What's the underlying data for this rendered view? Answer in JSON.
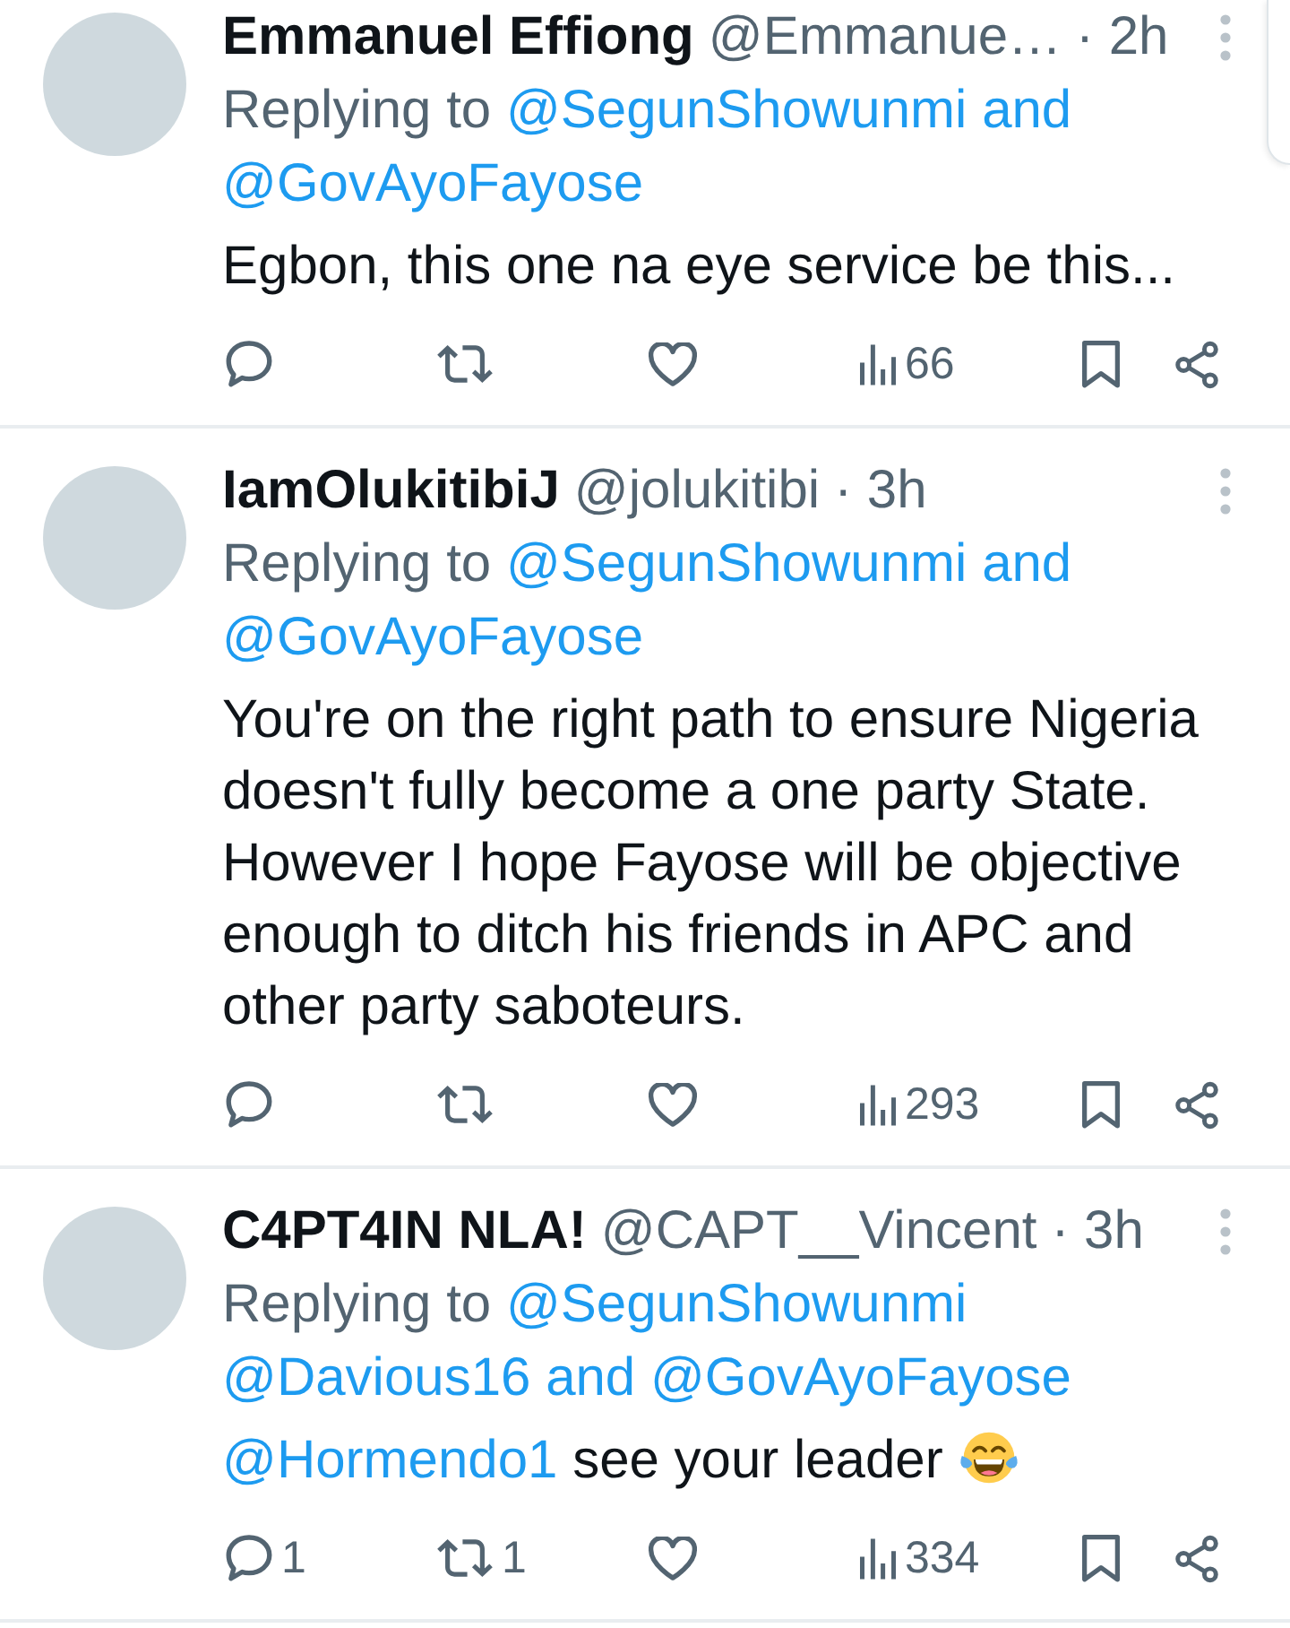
{
  "replies": [
    {
      "author": {
        "name": "Emmanuel Effiong",
        "handle": "@Emmanue…",
        "time": "· 2h"
      },
      "replying_to": {
        "label": "Replying to",
        "accounts": [
          "@SegunShowunmi",
          "@GovAyoFayose"
        ],
        "joiner": "and"
      },
      "body": [
        {
          "kind": "text",
          "text": "Egbon, this one na eye service be this..."
        }
      ],
      "actions": {
        "views": "66"
      }
    },
    {
      "author": {
        "name": "IamOlukitibiJ",
        "handle": "@jolukitibi",
        "time": "· 3h"
      },
      "replying_to": {
        "label": "Replying to",
        "accounts": [
          "@SegunShowunmi",
          "@GovAyoFayose"
        ],
        "joiner": "and"
      },
      "body": [
        {
          "kind": "text",
          "text": "You're on the right path to ensure Nigeria doesn't fully become a one party State. However I hope Fayose will be objective enough to ditch his friends in APC and other party saboteurs."
        }
      ],
      "actions": {
        "views": "293"
      }
    },
    {
      "author": {
        "name": "C4PT4IN NLA!",
        "handle": "@CAPT__Vincent",
        "time": "· 3h"
      },
      "replying_to": {
        "label": "Replying to",
        "accounts": [
          "@SegunShowunmi",
          "@Davious16",
          "@GovAyoFayose"
        ],
        "joiner": "and"
      },
      "body": [
        {
          "kind": "mention",
          "text": "@Hormendo1"
        },
        {
          "kind": "text",
          "text": "see your leader"
        },
        {
          "kind": "emoji"
        }
      ],
      "actions": {
        "replies": "1",
        "reposts": "1",
        "views": "334"
      }
    }
  ]
}
